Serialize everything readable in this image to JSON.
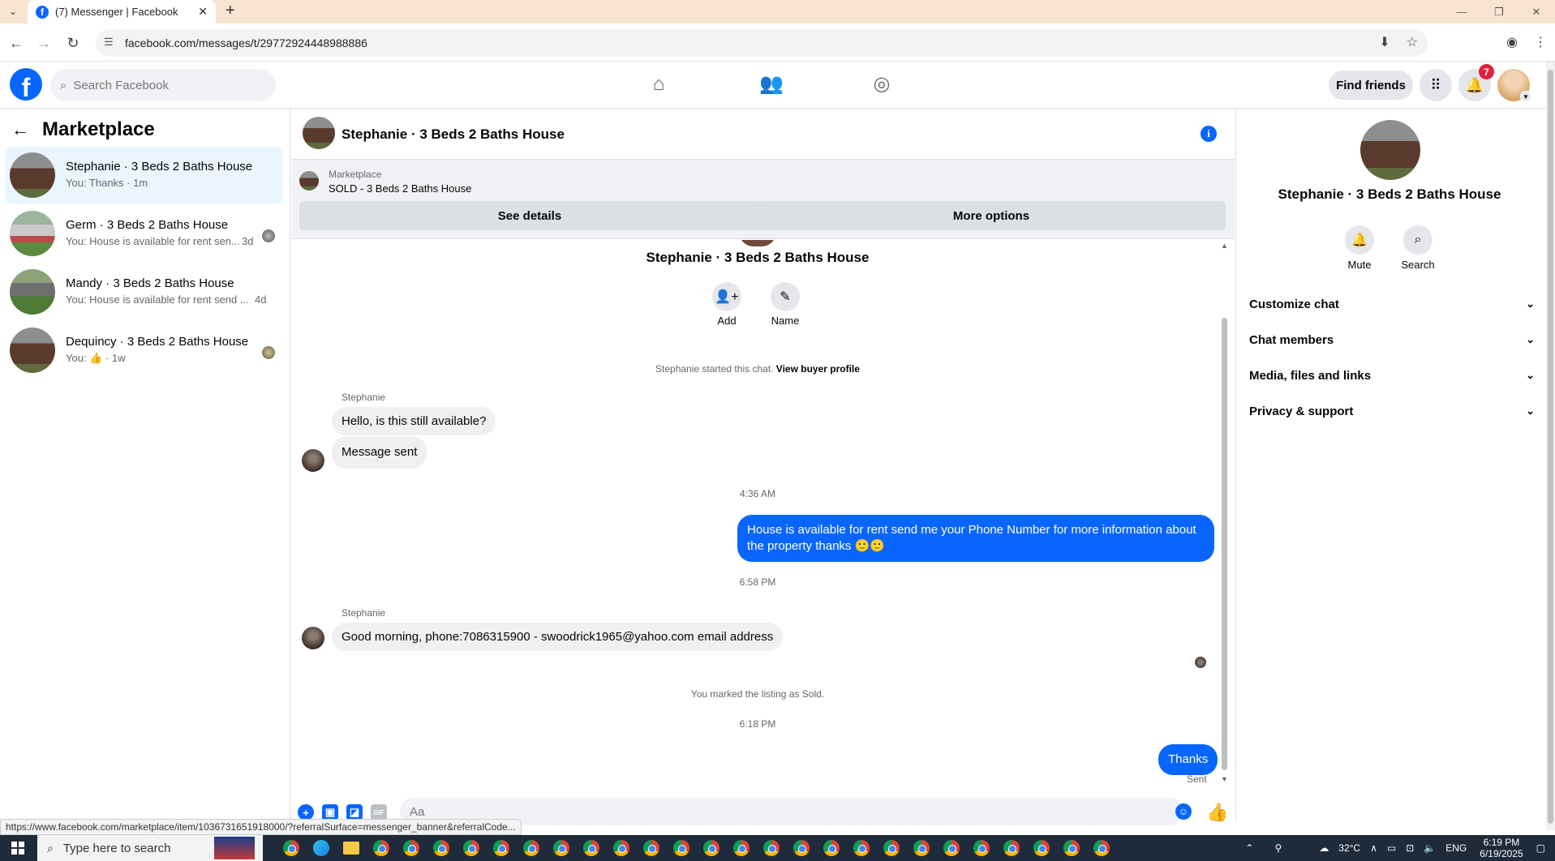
{
  "browser": {
    "tab_title": "(7) Messenger | Facebook",
    "url": "facebook.com/messages/t/29772924448988886",
    "status_url": "https://www.facebook.com/marketplace/item/1036731651918000/?referralSurface=messenger_banner&referralCode..."
  },
  "fb": {
    "search_placeholder": "Search Facebook",
    "find_friends": "Find friends",
    "notif_count": "7"
  },
  "sidebar": {
    "title": "Marketplace",
    "conversations": [
      {
        "title": "Stephanie · 3 Beds 2 Baths House",
        "preview": "You: Thanks · 1m",
        "time": ""
      },
      {
        "title": "Germ · 3 Beds 2 Baths House",
        "preview": "You: House is available for rent sen...",
        "time": "3d"
      },
      {
        "title": "Mandy · 3 Beds 2 Baths House",
        "preview": "You: House is available for rent send ...",
        "time": "4d"
      },
      {
        "title": "Dequincy · 3 Beds 2 Baths House",
        "preview": "You: ",
        "time": "1w"
      }
    ]
  },
  "chat": {
    "header_name": "Stephanie · 3 Beds 2 Baths House",
    "banner_label": "Marketplace",
    "banner_sold": "SOLD - 3 Beds 2 Baths House",
    "see_details": "See details",
    "more_options": "More options",
    "center_name": "Stephanie · 3 Beds 2 Baths House",
    "add_label": "Add",
    "name_label": "Name",
    "started_text": "Stephanie started this chat. ",
    "view_buyer": "View buyer profile",
    "sender": "Stephanie",
    "msg1": "Hello, is this still available?",
    "msg2": "Message sent",
    "time1": "4:36 AM",
    "msg3": "House is available for rent send me your Phone Number for more information about the property thanks 🙂🙂",
    "time2": "6:58 PM",
    "msg4": "Good morning,  phone:7086315900 - swoodrick1965@yahoo.com email address",
    "marked_sold": "You marked the listing as Sold.",
    "time3": "6:18 PM",
    "msg5": "Thanks",
    "sent": "Sent",
    "composer_placeholder": "Aa"
  },
  "right_panel": {
    "name": "Stephanie · 3 Beds 2 Baths House",
    "mute": "Mute",
    "search": "Search",
    "sections": [
      "Customize chat",
      "Chat members",
      "Media, files and links",
      "Privacy & support"
    ]
  },
  "taskbar": {
    "search_placeholder": "Type here to search",
    "temperature": "32°C",
    "language": "ENG",
    "time": "6:19 PM",
    "date": "6/19/2025"
  },
  "colors": {
    "accent": "#0866ff",
    "bubble_in": "#f0f0f0",
    "active_conv": "#ebf5ff"
  }
}
